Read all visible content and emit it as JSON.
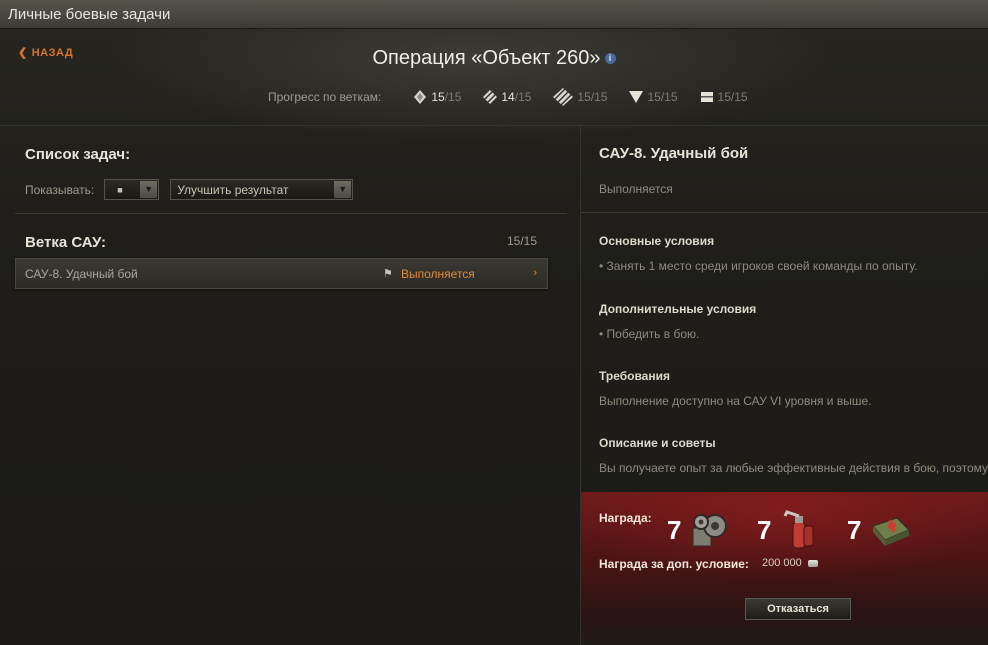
{
  "window": {
    "title": "Личные боевые задачи"
  },
  "header": {
    "back_label": "НАЗАД",
    "operation_title": "Операция «Объект 260»",
    "progress_label": "Прогресс по веткам:",
    "branches": [
      {
        "icon": "heavy-tank-icon",
        "current": "15",
        "total": "/15"
      },
      {
        "icon": "medium-tank-icon",
        "current": "14",
        "total": "/15"
      },
      {
        "icon": "light-tank-icon",
        "current": "15",
        "total": "/15"
      },
      {
        "icon": "td-icon",
        "current": "15",
        "total": "/15"
      },
      {
        "icon": "spg-icon",
        "current": "15",
        "total": "/15"
      }
    ]
  },
  "task_list": {
    "heading": "Список задач:",
    "filter_label": "Показывать:",
    "filter_type_value": "■",
    "filter_status_value": "Улучшить результат",
    "branch_title": "Ветка САУ:",
    "branch_count": "15/15",
    "tasks": [
      {
        "name": "САУ-8. Удачный бой",
        "flag": "⚑",
        "status": "Выполняется",
        "chevron": "›"
      }
    ]
  },
  "detail": {
    "title": "САУ-8. Удачный бой",
    "state": "Выполняется",
    "sections": [
      {
        "heading": "Основные условия",
        "text": "• Занять 1 место среди игроков своей команды по опыту."
      },
      {
        "heading": "Дополнительные условия",
        "text": "• Победить в бою."
      },
      {
        "heading": "Требования",
        "text": "Выполнение доступно на САУ VI уровня и выше."
      },
      {
        "heading": "Описание и советы",
        "text": "Вы получаете опыт за любые эффективные действия в бою, поэтому"
      }
    ]
  },
  "reward": {
    "label": "Награда:",
    "items": [
      {
        "count": "7",
        "icon": "gears-equipment-icon"
      },
      {
        "count": "7",
        "icon": "fire-extinguisher-icon"
      },
      {
        "count": "7",
        "icon": "first-aid-kit-icon"
      }
    ],
    "extra_label": "Награда за доп. условие:",
    "extra_value": "200 000",
    "refuse_button": "Отказаться"
  },
  "colors": {
    "accent": "#e08a3a",
    "reward_bg": "#6e1a1b"
  }
}
